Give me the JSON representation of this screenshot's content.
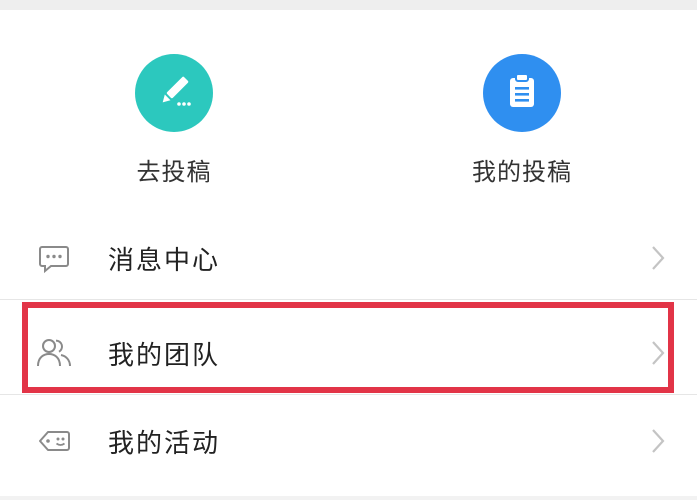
{
  "actions": [
    {
      "label": "去投稿",
      "icon": "pencil-icon",
      "color": "#2cc8be"
    },
    {
      "label": "我的投稿",
      "icon": "clipboard-icon",
      "color": "#2f8ff0"
    }
  ],
  "menu": [
    {
      "label": "消息中心",
      "icon": "message-icon"
    },
    {
      "label": "我的团队",
      "icon": "team-icon",
      "highlighted": true
    },
    {
      "label": "我的活动",
      "icon": "tag-icon"
    }
  ],
  "colors": {
    "highlight": "#e23447",
    "icon_gray": "#8a8a8a",
    "chevron": "#c4c4c4"
  }
}
